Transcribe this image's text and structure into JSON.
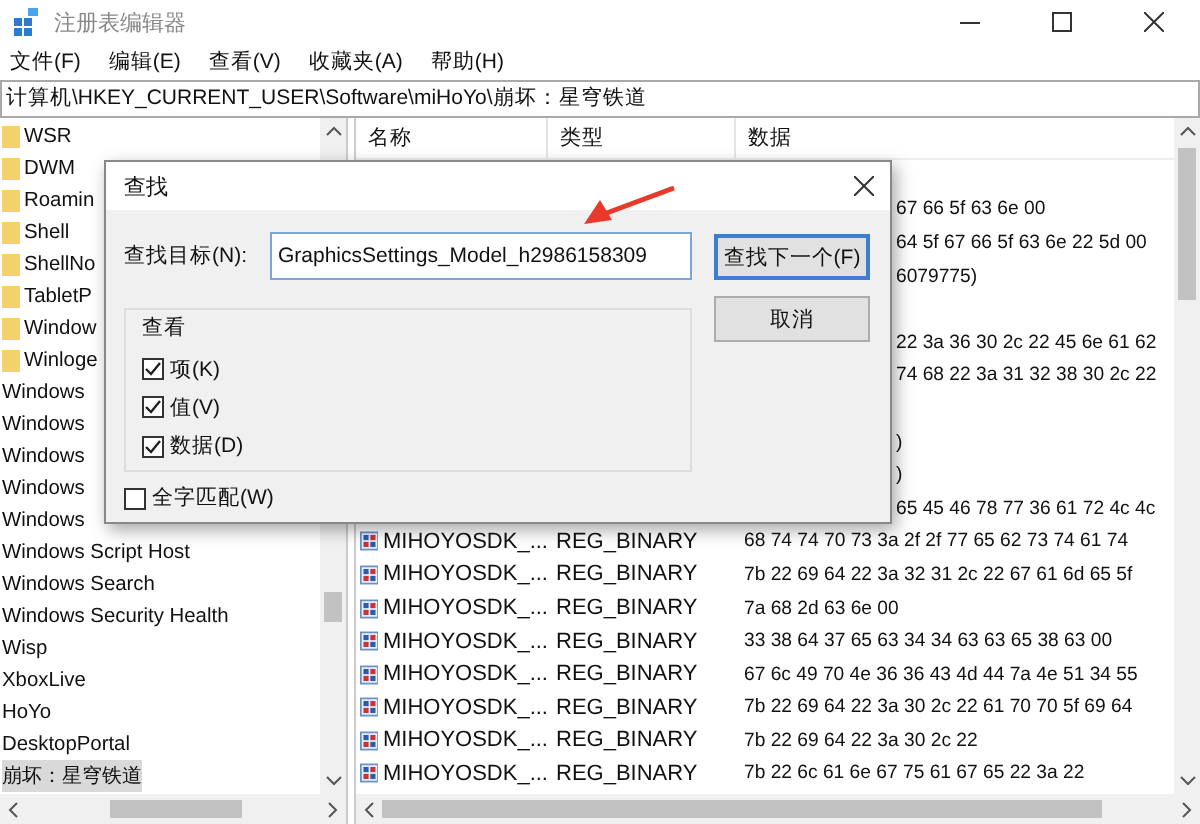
{
  "window": {
    "title": "注册表编辑器"
  },
  "menu": [
    "文件(F)",
    "编辑(E)",
    "查看(V)",
    "收藏夹(A)",
    "帮助(H)"
  ],
  "address": "计算机\\HKEY_CURRENT_USER\\Software\\miHoYo\\崩坏：星穹铁道",
  "tree": [
    {
      "label": "WSR",
      "folder": true,
      "selected": false
    },
    {
      "label": "DWM",
      "folder": true,
      "selected": false
    },
    {
      "label": "Roamin",
      "folder": true,
      "selected": false
    },
    {
      "label": "Shell",
      "folder": true,
      "selected": false
    },
    {
      "label": "ShellNo",
      "folder": true,
      "selected": false
    },
    {
      "label": "TabletP",
      "folder": true,
      "selected": false
    },
    {
      "label": "Window",
      "folder": true,
      "selected": false
    },
    {
      "label": "Winloge",
      "folder": true,
      "selected": false
    },
    {
      "label": "Windows",
      "folder": false,
      "selected": false
    },
    {
      "label": "Windows",
      "folder": false,
      "selected": false
    },
    {
      "label": "Windows",
      "folder": false,
      "selected": false
    },
    {
      "label": "Windows",
      "folder": false,
      "selected": false
    },
    {
      "label": "Windows",
      "folder": false,
      "selected": false
    },
    {
      "label": "Windows Script Host",
      "folder": false,
      "selected": false
    },
    {
      "label": "Windows Search",
      "folder": false,
      "selected": false
    },
    {
      "label": "Windows Security Health",
      "folder": false,
      "selected": false
    },
    {
      "label": "Wisp",
      "folder": false,
      "selected": false
    },
    {
      "label": "XboxLive",
      "folder": false,
      "selected": false
    },
    {
      "label": "HoYo",
      "folder": false,
      "selected": false
    },
    {
      "label": "DesktopPortal",
      "folder": false,
      "selected": false
    },
    {
      "label": "崩坏：星穹铁道",
      "folder": false,
      "selected": true
    }
  ],
  "list": {
    "columns": [
      "名称",
      "类型",
      "数据"
    ],
    "rows": [
      {
        "kind": "covered"
      },
      {
        "kind": "covered",
        "data": "67 66 5f 63 6e 00"
      },
      {
        "kind": "covered",
        "data": "64 5f 67 66 5f 63 6e 22 5d 00"
      },
      {
        "kind": "covered",
        "data": "6079775)"
      },
      {
        "kind": "covered"
      },
      {
        "kind": "covered",
        "data": "22 3a 36 30 2c 22 45 6e 61 62"
      },
      {
        "kind": "covered",
        "data": "74 68 22 3a 31 32 38 30 2c 22"
      },
      {
        "kind": "covered"
      },
      {
        "kind": "covered",
        "data": ")"
      },
      {
        "kind": "covered",
        "data": ")"
      },
      {
        "kind": "covered",
        "data": "65 45 46 78 77 36 61 72 4c 4c"
      },
      {
        "kind": "value",
        "name": "MIHOYOSDK_...",
        "type": "REG_BINARY",
        "data": "68 74 74 70 73 3a 2f 2f 77 65 62 73 74 61 74"
      },
      {
        "kind": "value",
        "name": "MIHOYOSDK_...",
        "type": "REG_BINARY",
        "data": "7b 22 69 64 22 3a 32 31 2c 22 67 61 6d 65 5f"
      },
      {
        "kind": "value",
        "name": "MIHOYOSDK_...",
        "type": "REG_BINARY",
        "data": "7a 68 2d 63 6e 00"
      },
      {
        "kind": "value",
        "name": "MIHOYOSDK_...",
        "type": "REG_BINARY",
        "data": "33 38 64 37 65 63 34 34 63 63 65 38 63 00"
      },
      {
        "kind": "value",
        "name": "MIHOYOSDK_...",
        "type": "REG_BINARY",
        "data": "67 6c 49 70 4e 36 36 43 4d 44 7a 4e 51 34 55"
      },
      {
        "kind": "value",
        "name": "MIHOYOSDK_...",
        "type": "REG_BINARY",
        "data": "7b 22 69 64 22 3a 30 2c 22 61 70 70 5f 69 64"
      },
      {
        "kind": "value",
        "name": "MIHOYOSDK_...",
        "type": "REG_BINARY",
        "data": "7b 22 69 64 22 3a 30 2c 22"
      },
      {
        "kind": "value",
        "name": "MIHOYOSDK_...",
        "type": "REG_BINARY",
        "data": "7b 22 6c 61 6e 67 75 61 67 65 22 3a 22"
      }
    ]
  },
  "dialog": {
    "title": "查找",
    "find_label": "查找目标(N):",
    "find_value": "GraphicsSettings_Model_h2986158309",
    "group_title": "查看",
    "options": [
      {
        "label": "项(K)",
        "checked": true
      },
      {
        "label": "值(V)",
        "checked": true
      },
      {
        "label": "数据(D)",
        "checked": true
      }
    ],
    "match_whole": {
      "label": "全字匹配(W)",
      "checked": false
    },
    "buttons": [
      {
        "label": "查找下一个(F)",
        "selected": true
      },
      {
        "label": "取消",
        "selected": false
      }
    ]
  }
}
